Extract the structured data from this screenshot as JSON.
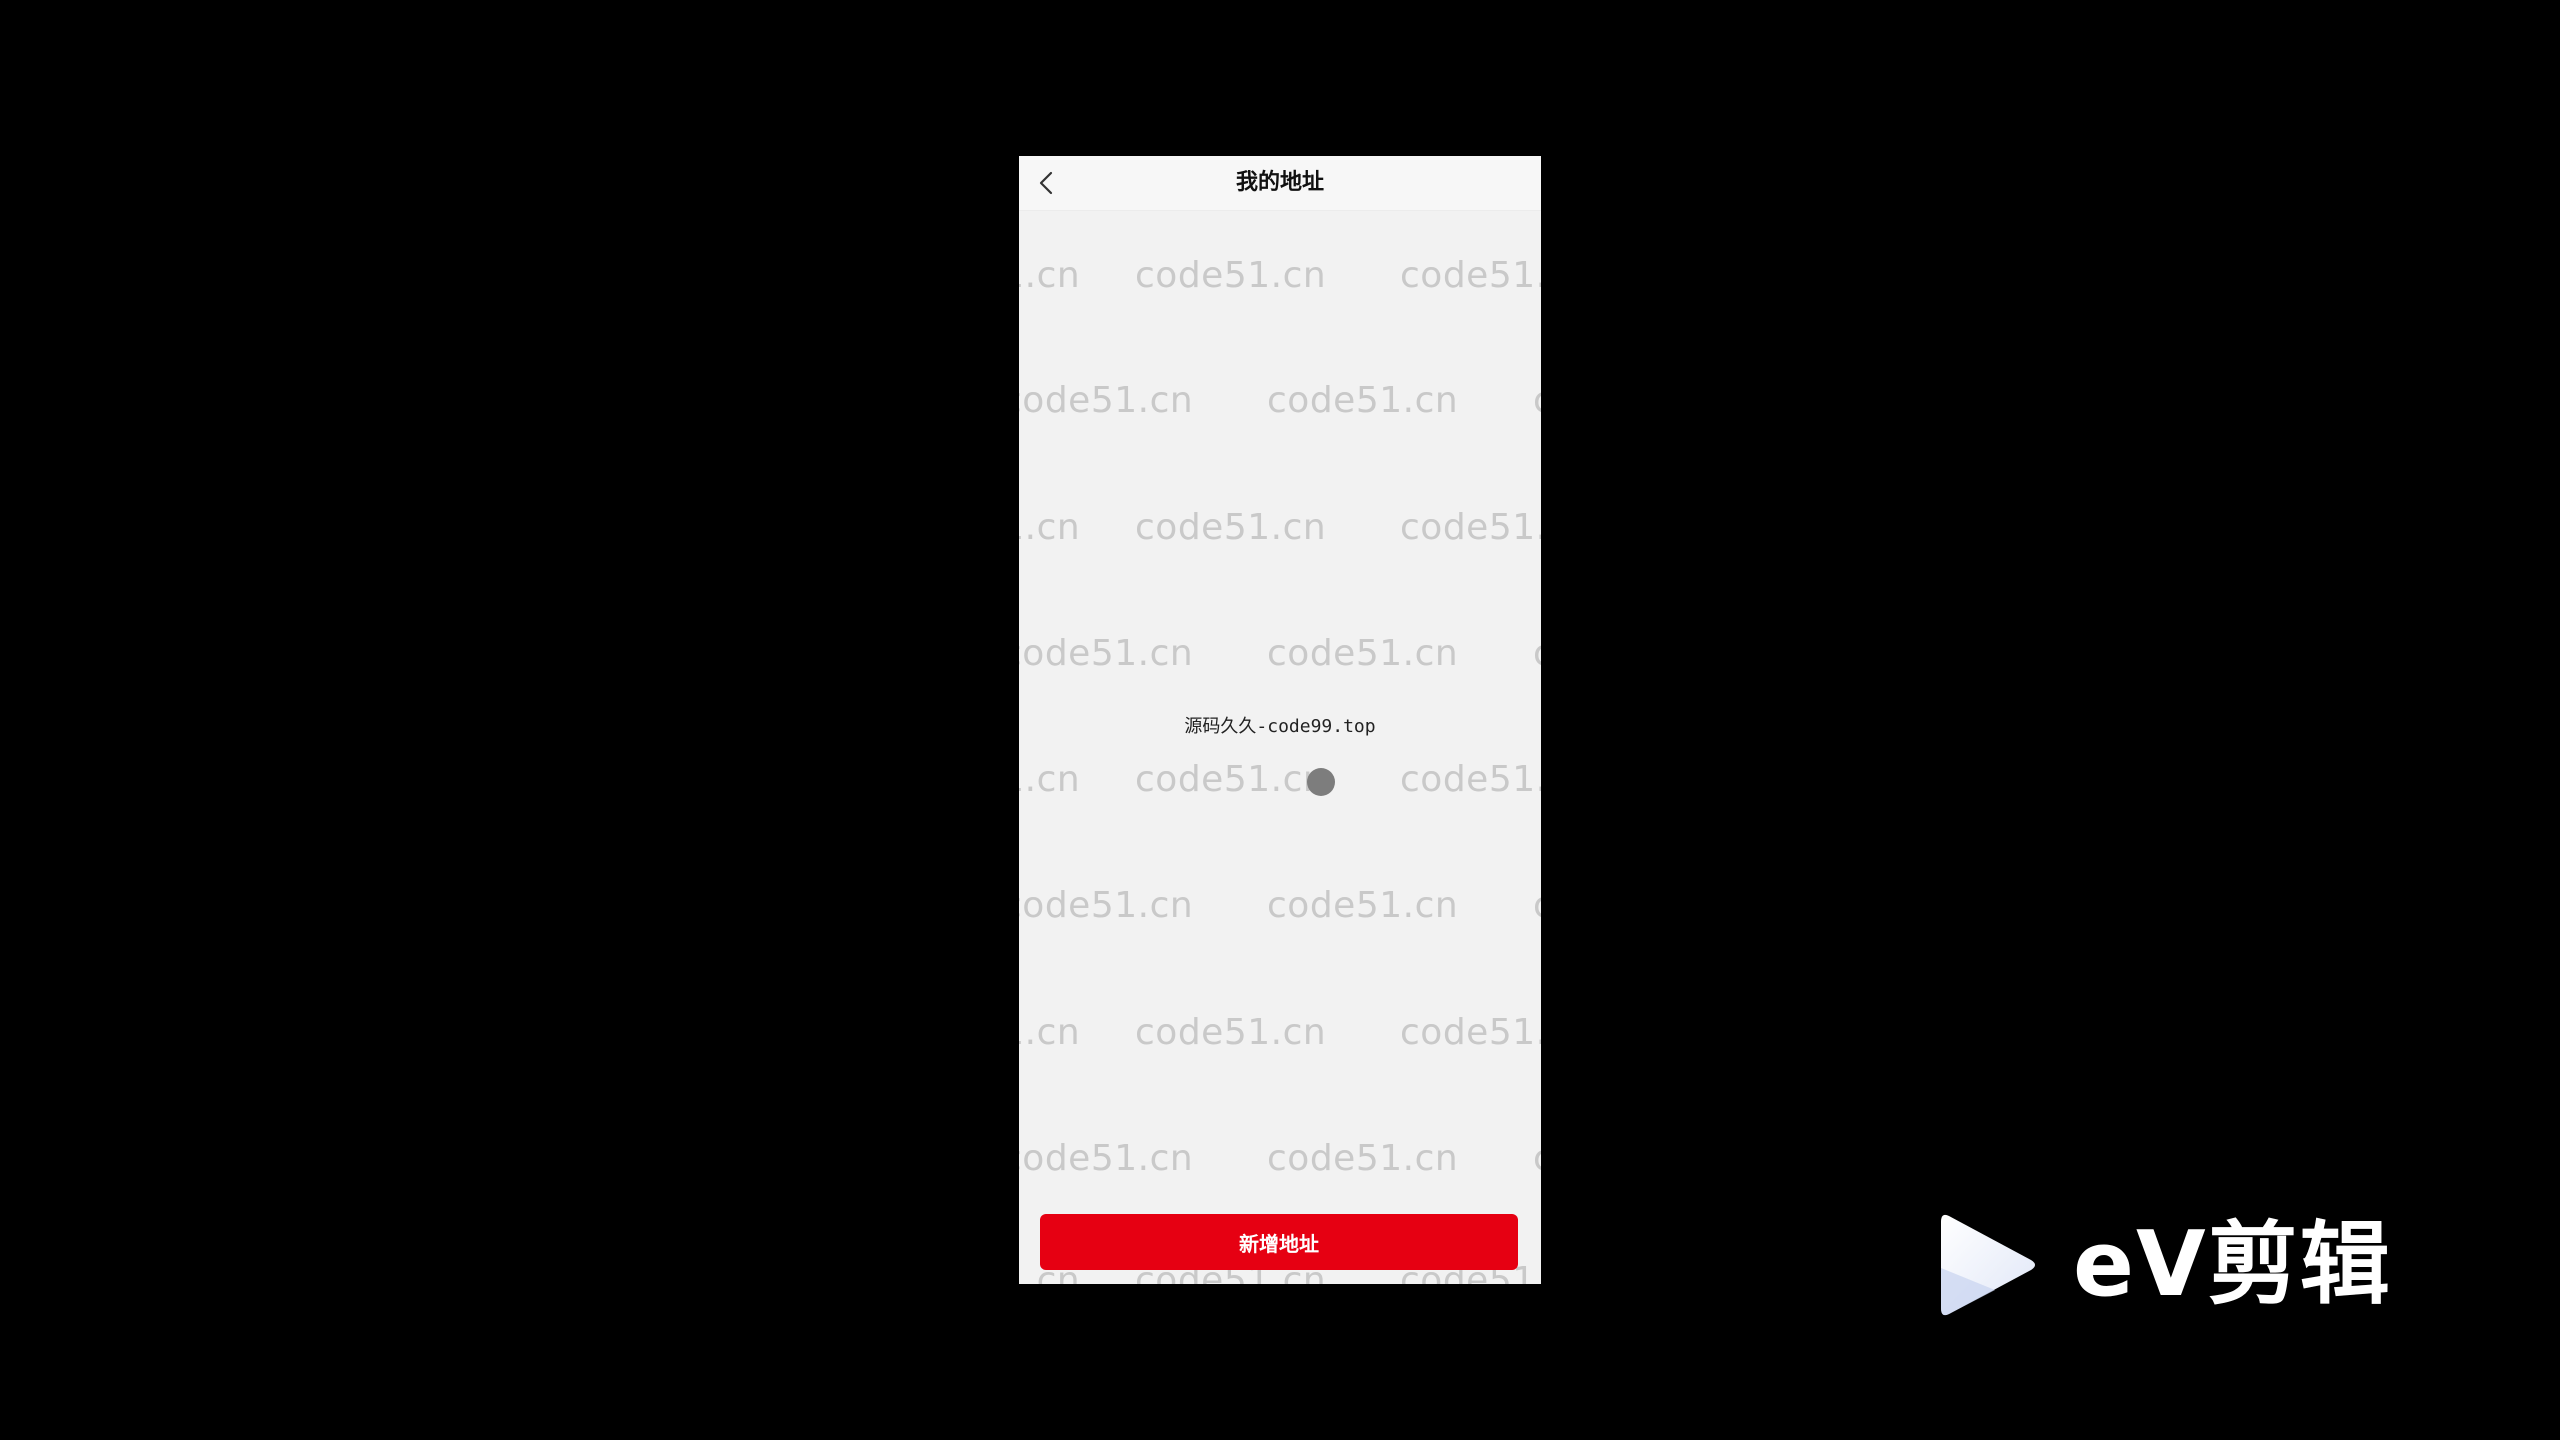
{
  "app": {
    "title": "我的地址",
    "empty_message": "源码久久-code99.top",
    "add_button_label": "新增地址",
    "accent_color": "#e60012",
    "background_color": "#f2f2f2"
  },
  "watermark": {
    "text": "code51.cn"
  },
  "overlay_brand": {
    "text": "eV剪辑",
    "icon": "play-icon"
  },
  "icons": {
    "back": "chevron-left-icon"
  }
}
